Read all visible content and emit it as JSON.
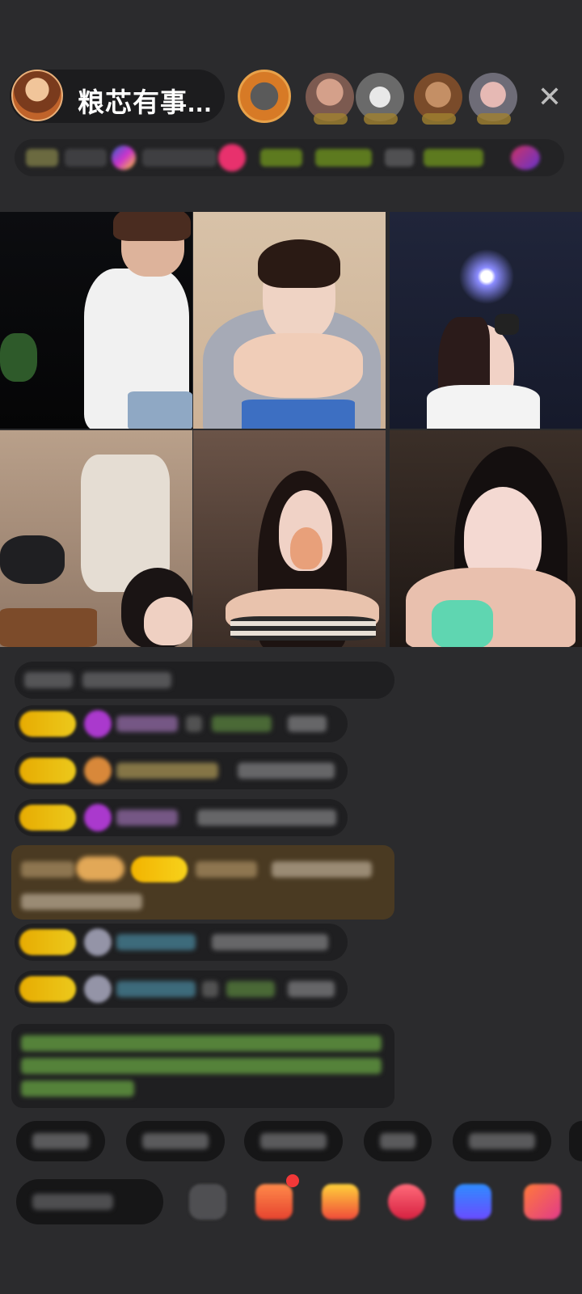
{
  "header": {
    "host_name": "粮芯有事...",
    "close_icon": "close-icon",
    "viewer_avatars": [
      "viewer-1",
      "viewer-2",
      "viewer-3",
      "viewer-4",
      "viewer-5"
    ]
  },
  "video_grid": {
    "tiles": [
      "tile-1",
      "tile-2",
      "tile-3",
      "tile-4",
      "tile-5",
      "tile-6"
    ]
  },
  "colors": {
    "background": "#2b2b2d",
    "level_badge": "#f2b300",
    "gift_banner": "#4a3a22",
    "notice_text": "#79b84c",
    "viewer_highlight": "#e8a24a"
  },
  "bottom_bar": {
    "icons": [
      "emoji-icon",
      "gift-box-icon",
      "gift-icon",
      "red-packet-icon",
      "game-icon",
      "more-icon"
    ]
  }
}
